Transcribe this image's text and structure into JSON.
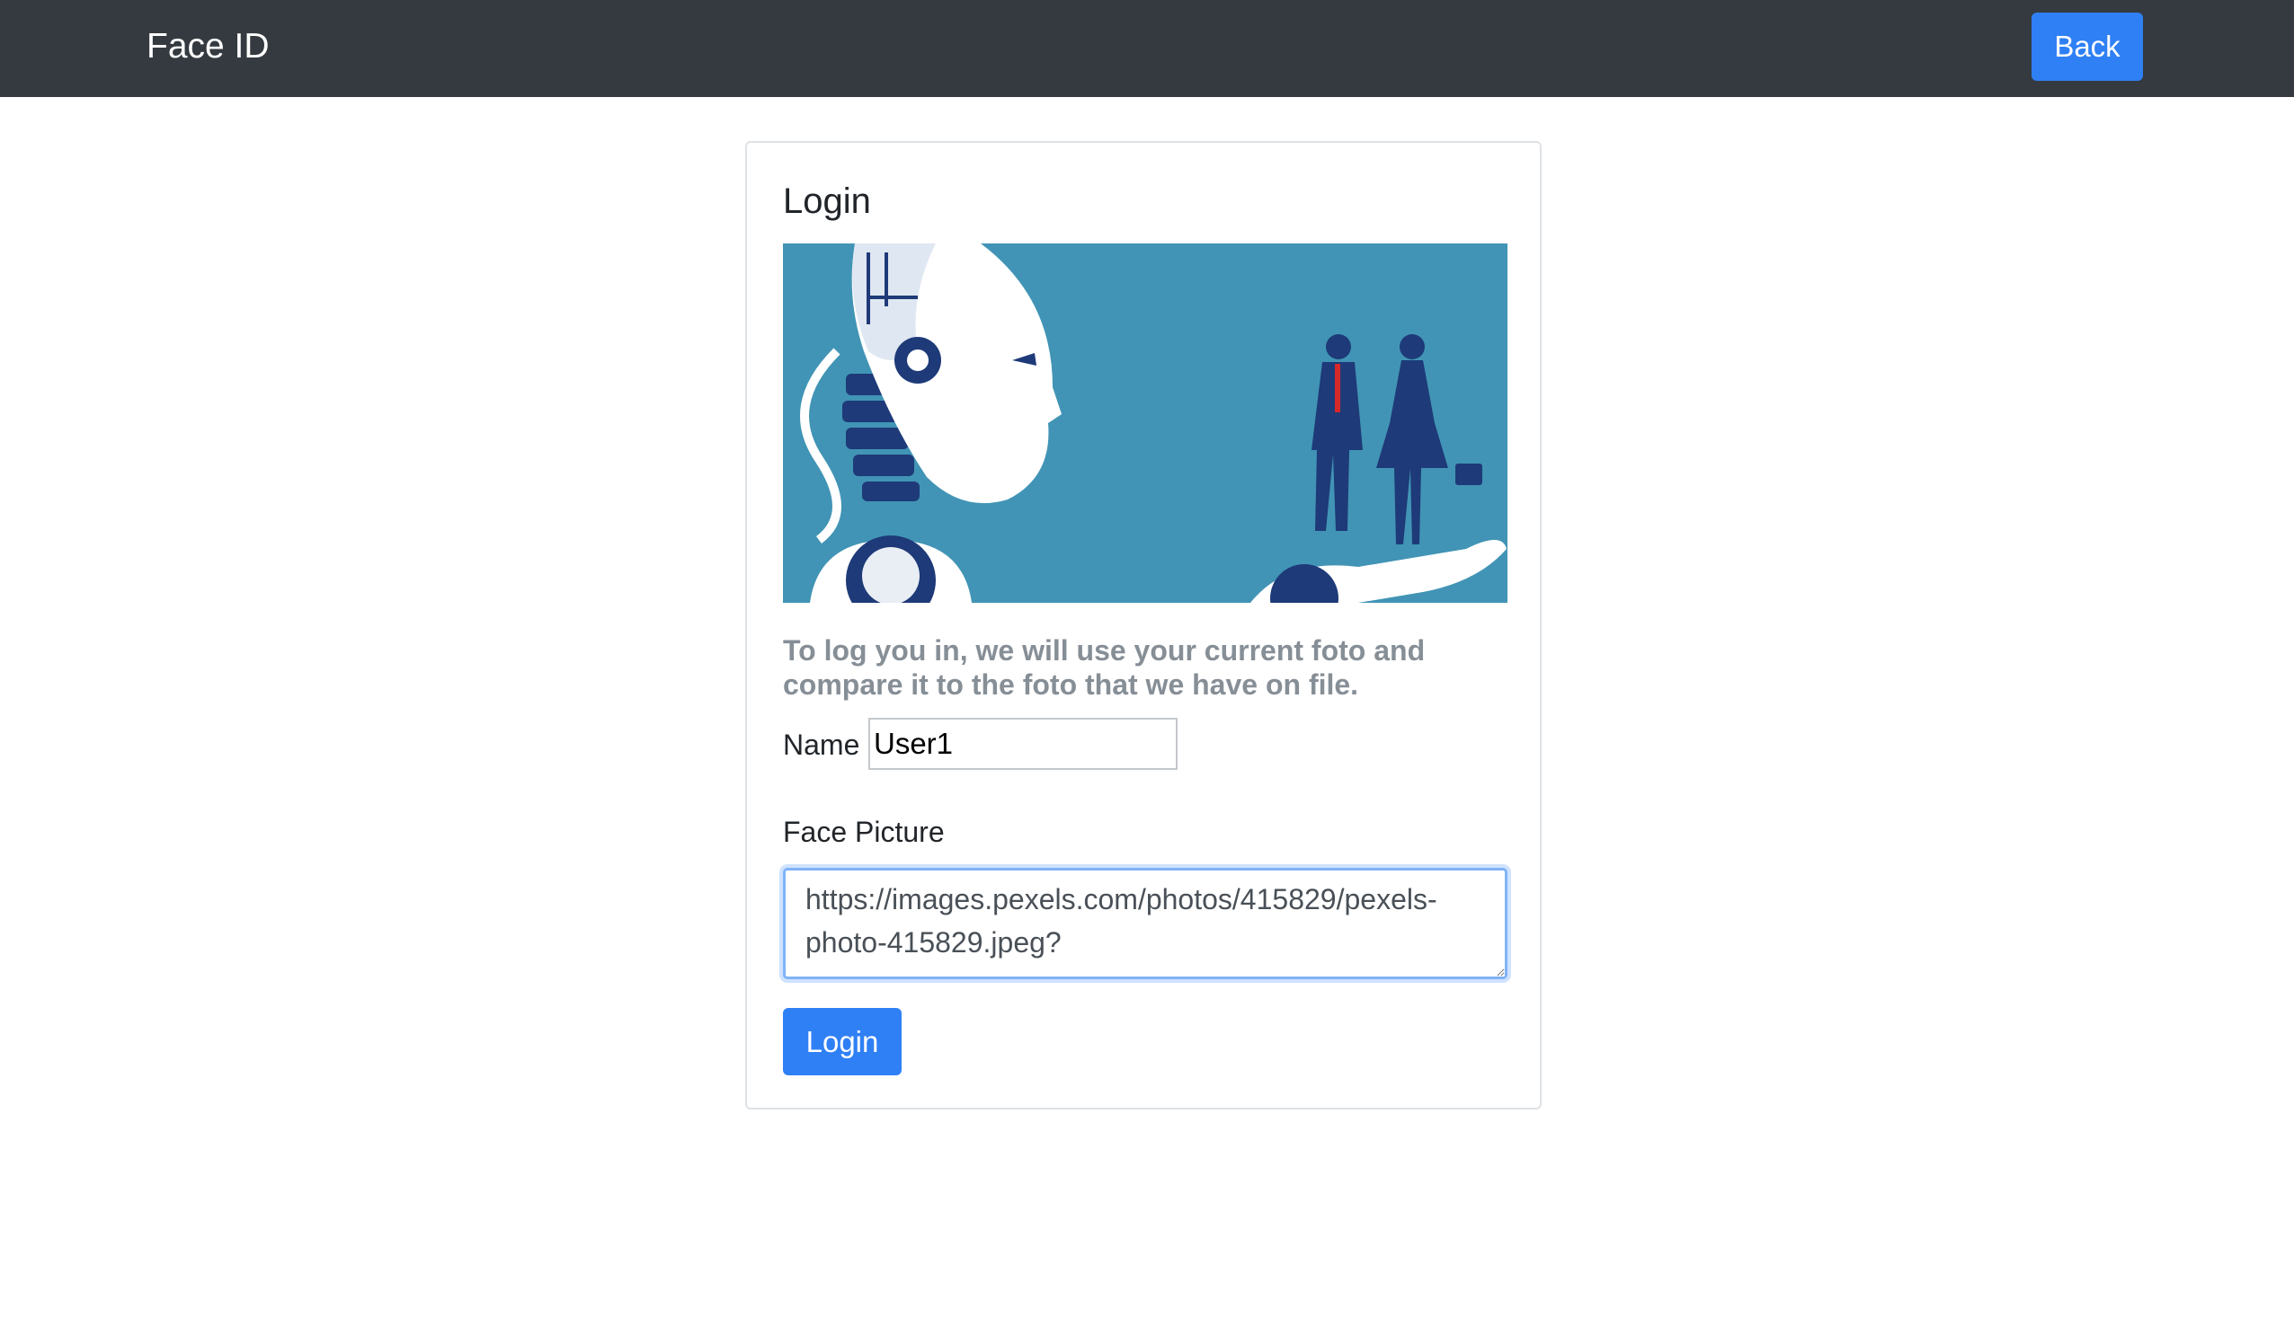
{
  "navbar": {
    "brand": "Face ID",
    "back_label": "Back"
  },
  "card": {
    "title": "Login",
    "hero_image": "robot-and-business-people-illustration",
    "description": "To log you in, we will use your current foto and compare it to the foto that we have on file.",
    "name_label": "Name",
    "name_value": "User1",
    "face_label": "Face Picture",
    "face_value": "https://images.pexels.com/photos/415829/pexels-photo-415829.jpeg?",
    "login_label": "Login"
  },
  "colors": {
    "navbar_bg": "#343a40",
    "primary": "#2f80f5",
    "hero_bg": "#4194b5",
    "muted_text": "#868e96"
  }
}
